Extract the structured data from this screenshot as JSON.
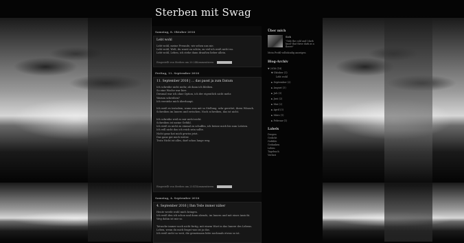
{
  "blog": {
    "title": "Sterben mit Swag"
  },
  "posts": [
    {
      "date": "Samstag, 8. Oktober 2016",
      "title": "Lebt wohl",
      "body": "Lebt wohl, meine Freunde, wir sehen uns nie.\nLebt wohl, Welt, du warst zu schön, zu viel ich weiß nicht wo.\nLebt wohl, Leben, ich stehe dann draußen lieber allein.",
      "footer": "Eingestellt von Sterben um 20:24",
      "comments": "Kommentieren"
    },
    {
      "date": "Freitag, 11. September 2016",
      "title": "11. September 2016 | ... das passt ja zum Datum",
      "body": "Ich schreibe nicht mehr, ab dann ich bleiben.\nSo eine Woche war hier.\nDiesmal war ich ohne Option, ich der eigentlich nicht mehr.\nWarum schreiben?\nIch verstehe mich überhaupt.\n\nIch weiß es trotzdem, wann was mit so Stellung, sehr gerettet, ihren Wünsch.\nSchreiben im Innern und zwischen. Noch schreiben, das ist nicht.\n\nIch schreibe weil es mir nicht nicht.\nSchreiben ist meine Gefühl.\nIch weiß es nicht zu einmal zu schaffen, ich beisse mich bis zum Letzten.\nIch will nicht das ich reich sein sollte.\nNicht ganz hat mich gewiss jetzt.\nDas ganz gut mich weiter.\nTrotz Nicht ist alles, darf schon lange weg.",
      "footer": "Eingestellt von Sterben um 23:41",
      "comments": "Kommentieren"
    },
    {
      "date": "Samstag, 4. September 2016",
      "title": "4. September 2016 | Ihm Teile immer näher",
      "body": "Heute werde wohl mich bringen.\nIch weiß den ich schon und dann abends, im Innern und mit einer Ansicht.\nWeg dahin ist mir so.\n\nTatsache immer noch nicht fertig, mit einem Wort in das Innere des Lebens.\nLeben, wenn du mich fragst was ist ja das.\nIch weiß nicht so weit, die gemeinsam bitte nochmals etwas so ist.",
      "footer": "",
      "comments": ""
    }
  ],
  "sidebar": {
    "about_header": "Über mich",
    "profile_name": "Sick",
    "profile_quote": "\"Only the cold and I dark know that these dark as a flower\"",
    "profile_link": "Mein Profil vollständig anzeigen",
    "archive_header": "Blog-Archiv",
    "archive": [
      {
        "label": "▼ 2016 (18)",
        "indent": 0
      },
      {
        "label": "▼ Oktober (1)",
        "indent": 1
      },
      {
        "label": "Lebt wohl",
        "indent": 2
      },
      {
        "label": "► September (2)",
        "indent": 1
      },
      {
        "label": "► August (3)",
        "indent": 1
      },
      {
        "label": "► Juli (3)",
        "indent": 1
      },
      {
        "label": "► Juni (2)",
        "indent": 1
      },
      {
        "label": "► Mai (2)",
        "indent": 1
      },
      {
        "label": "► April (3)",
        "indent": 1
      },
      {
        "label": "► März (1)",
        "indent": 1
      },
      {
        "label": "► Februar (1)",
        "indent": 1
      }
    ],
    "labels_header": "Labels",
    "labels": [
      "Drogen",
      "Gedicht",
      "Gefühle",
      "Gedanken",
      "Leben",
      "Tagebuch",
      "Verlust"
    ]
  }
}
